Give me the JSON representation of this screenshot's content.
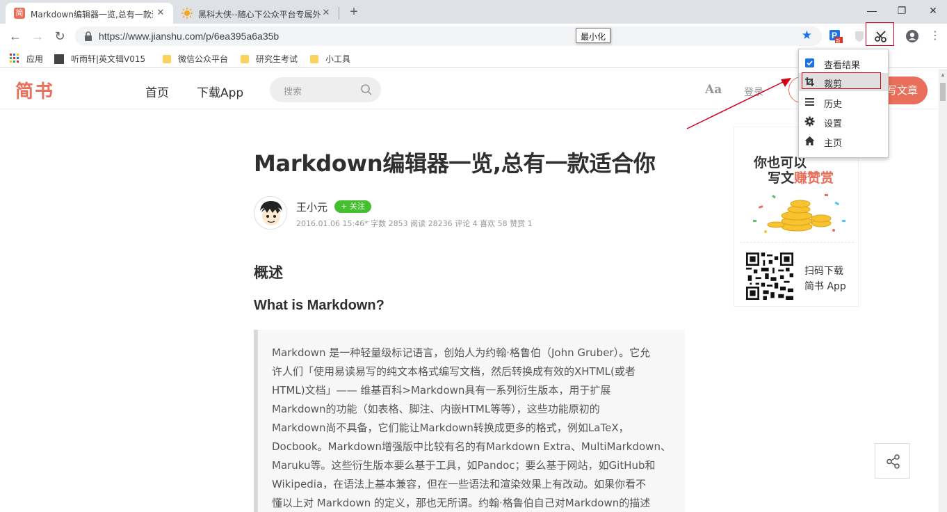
{
  "browser": {
    "tabs": [
      {
        "title": "Markdown编辑器一览,总有一款适合你",
        "favicon": "简",
        "favicon_color": "#ea6f5a"
      },
      {
        "title": "黑科大侠--随心下公众平台专属外链",
        "favicon": "sun-icon",
        "favicon_color": "#f5a623"
      }
    ],
    "new_tab": "+",
    "window_controls": {
      "minimize": "—",
      "restore": "❐",
      "close": "✕"
    },
    "url": "https://www.jianshu.com/p/6ea395a6a35b",
    "tooltip": "最小化",
    "bookmarks": [
      {
        "label": "应用",
        "icon": "apps-grid-icon"
      },
      {
        "label": "听雨轩|英文辑V015",
        "icon": "bookmark-favicon"
      },
      {
        "label": "微信公众平台",
        "icon": "folder-icon"
      },
      {
        "label": "研究生考试",
        "icon": "folder-icon"
      },
      {
        "label": "小工具",
        "icon": "folder-icon"
      }
    ]
  },
  "popup_menu": {
    "items": [
      {
        "label": "查看结果",
        "icon": "checkbox-checked-icon"
      },
      {
        "label": "裁剪",
        "icon": "crop-icon"
      },
      {
        "label": "历史",
        "icon": "list-icon"
      },
      {
        "label": "设置",
        "icon": "gear-icon"
      },
      {
        "label": "主页",
        "icon": "home-icon"
      }
    ],
    "highlight_color": "#d0021b"
  },
  "site": {
    "logo": "简书",
    "nav": [
      "首页",
      "下载App"
    ],
    "search_placeholder": "搜索",
    "font_toggle": "Aa",
    "login": "登录",
    "write_button": "写文章",
    "accent_color": "#ea6f5a"
  },
  "article": {
    "title": "Markdown编辑器一览,总有一款适合你",
    "author": "王小元",
    "follow": "+ 关注",
    "meta": "2016.01.06 15:46*  字数 2853  阅读 28236 评论 4 喜欢 58 赞赏 1",
    "h_overview": "概述",
    "h_what": "What is Markdown?",
    "quote_lines": [
      "Markdown 是一种轻量级标记语言，创始人为约翰·格鲁伯（John Gruber）。它允",
      "许人们「使用易读易写的纯文本格式编写文档，然后转换成有效的XHTML(或者",
      "HTML)文档」—— 维基百科>Markdown具有一系列衍生版本，用于扩展",
      "Markdown的功能（如表格、脚注、内嵌HTML等等），这些功能原初的",
      "Markdown尚不具备，它们能让Markdown转换成更多的格式，例如LaTeX，",
      "Docbook。Markdown增强版中比较有名的有Markdown Extra、MultiMarkdown、",
      "Maruku等。这些衍生版本要么基于工具，如Pandoc；要么基于网站，如GitHub和",
      "Wikipedia，在语法上基本兼容，但在一些语法和渲染效果上有改动。如果你看不",
      "懂以上对 Markdown 的定义，那也无所谓。约翰·格鲁伯自己对Markdown的描述"
    ]
  },
  "sidebar_ad": {
    "line1": "你也可以",
    "line2_plain": "写文",
    "line2_accent": "赚赞赏",
    "download_line1": "扫码下载",
    "download_line2": "简书 App"
  }
}
